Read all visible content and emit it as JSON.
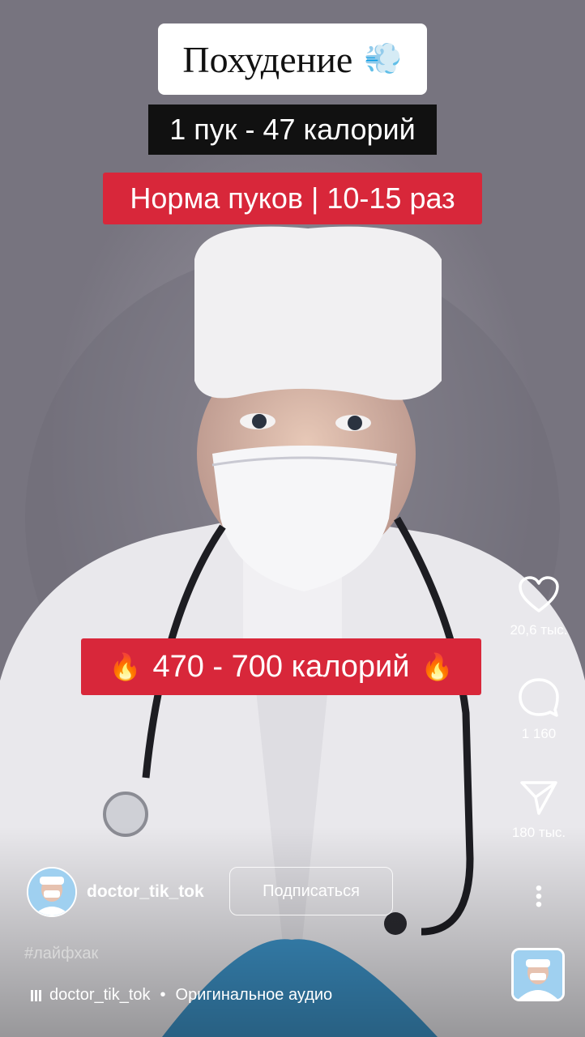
{
  "captions": {
    "title": "Похудение",
    "title_emoji": "dash-symbol",
    "line1": "1 пук - 47 калорий",
    "line2": "Норма пуков | 10-15 раз",
    "line3": "470 - 700 калорий",
    "line3_emoji": "fire"
  },
  "actions": {
    "likes": "20,6 тыс.",
    "comments": "1 160",
    "shares": "180 тыс."
  },
  "author": {
    "username": "doctor_tik_tok",
    "follow_label": "Подписаться"
  },
  "hashtag": "#лайфхак",
  "audio": {
    "artist": "doctor_tik_tok",
    "separator": "•",
    "track": "Оригинальное аудио"
  },
  "colors": {
    "caption_red": "#d8273a",
    "caption_dark": "#111111"
  }
}
